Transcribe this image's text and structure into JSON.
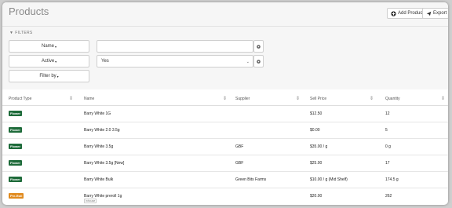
{
  "header": {
    "title": "Products",
    "add_label": "Add Product",
    "export_label": "Export"
  },
  "filters": {
    "label": "FILTERS",
    "name_btn": "Name",
    "active_btn": "Active",
    "filterby_btn": "Filter by",
    "name_value": "",
    "active_value": "Yes"
  },
  "table": {
    "headers": [
      "Product Type",
      "Name",
      "Supplier",
      "Sell Price",
      "Quantity"
    ],
    "rows": [
      {
        "type": "Flower",
        "type_color": "#1e6b3a",
        "name": "Barry White 1G",
        "tag": "",
        "supplier": "",
        "price": "$12.50",
        "qty": "12"
      },
      {
        "type": "Flower",
        "type_color": "#1e6b3a",
        "name": "Barry White 2.0 3.5g",
        "tag": "",
        "supplier": "",
        "price": "$0.00",
        "qty": "5"
      },
      {
        "type": "Flower",
        "type_color": "#1e6b3a",
        "name": "Barry White 3.5g",
        "tag": "",
        "supplier": "GBF",
        "price": "$35.00 / g",
        "qty": "0 g"
      },
      {
        "type": "Flower",
        "type_color": "#1e6b3a",
        "name": "Barry White 3.5g [New]",
        "tag": "",
        "supplier": "GBF",
        "price": "$25.00",
        "qty": "17"
      },
      {
        "type": "Flower",
        "type_color": "#1e6b3a",
        "name": "Barry White Bulk",
        "tag": "",
        "supplier": "Green Bits Farms",
        "price": "$10.00 / g (Mid Shelf)",
        "qty": "174.5 g"
      },
      {
        "type": "Pre-Roll",
        "type_color": "#e08a1e",
        "name": "Barry White preroll 1g",
        "tag": "inhouse",
        "supplier": "",
        "price": "$20.00",
        "qty": "262"
      }
    ]
  }
}
